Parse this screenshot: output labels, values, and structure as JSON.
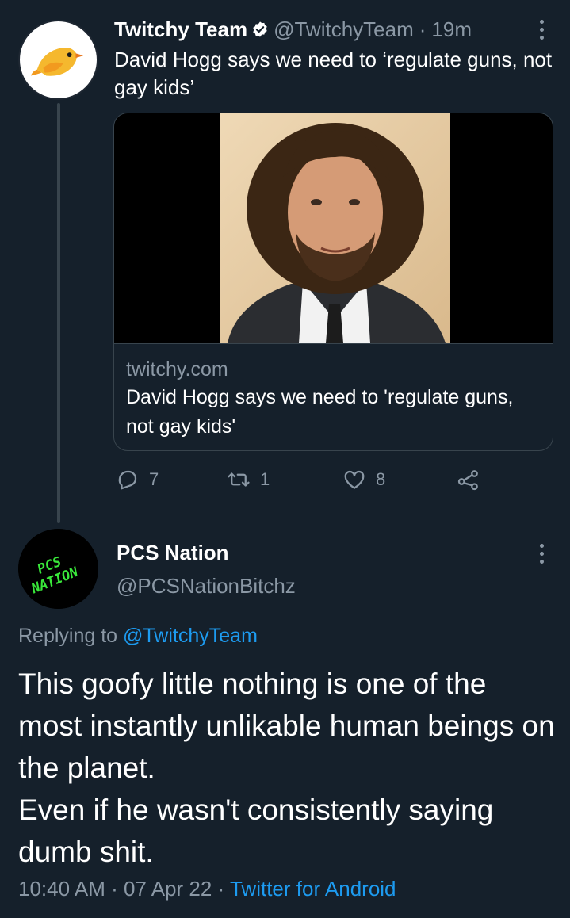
{
  "tweet": {
    "author_name": "Twitchy Team",
    "handle": "@TwitchyTeam",
    "separator": "·",
    "time_ago": "19m",
    "text": "David Hogg says we need to ‘regulate guns, not gay kids’",
    "verified": true,
    "avatar_icon": "yellow-bird-icon",
    "card": {
      "domain": "twitchy.com",
      "title": "David Hogg says we need to 'regulate guns, not gay kids'"
    },
    "actions": {
      "replies": "7",
      "retweets": "1",
      "likes": "8"
    }
  },
  "reply": {
    "author_name": "PCS Nation",
    "handle": "@PCSNationBitchz",
    "avatar_text": [
      "PCS",
      "NATION"
    ],
    "replying_prefix": "Replying to",
    "replying_handle": "@TwitchyTeam",
    "body_lines": [
      "This goofy little nothing is one of the most instantly unlikable human beings on the planet.",
      "Even if he wasn't consistently saying dumb shit."
    ],
    "time": "10:40 AM",
    "dot": "·",
    "date": "07 Apr 22",
    "source": "Twitter for Android"
  },
  "colors": {
    "background": "#15202b",
    "secondary_text": "#8b98a5",
    "link": "#1d9bf0",
    "border": "#38444d",
    "avatar_green": "#39e83a"
  }
}
